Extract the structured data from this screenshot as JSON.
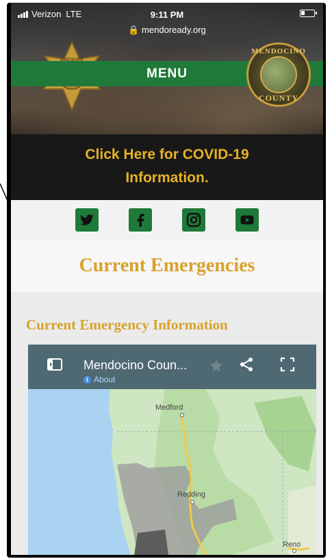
{
  "status_bar": {
    "carrier": "Verizon",
    "network": "LTE",
    "time": "9:11 PM",
    "url": "mendoready.org"
  },
  "header": {
    "menu_label": "MENU",
    "badge_text": "SHERIFF",
    "seal_top": "MENDOCINO",
    "seal_bottom": "COUNTY"
  },
  "covid_banner": {
    "line1": "Click Here for COVID-19",
    "line2": "Information."
  },
  "social": [
    "twitter-icon",
    "facebook-icon",
    "instagram-icon",
    "youtube-icon"
  ],
  "emergencies": {
    "heading": "Current Emergencies",
    "info_title": "Current Emergency Information"
  },
  "map": {
    "title": "Mendocino Coun...",
    "about": "About",
    "places": {
      "medford": "Medford",
      "redding": "Redding",
      "reno": "Reno"
    }
  },
  "colors": {
    "brand_green": "#1f7a3a",
    "accent_gold": "#d9a12a",
    "map_bar": "#4f6973"
  }
}
